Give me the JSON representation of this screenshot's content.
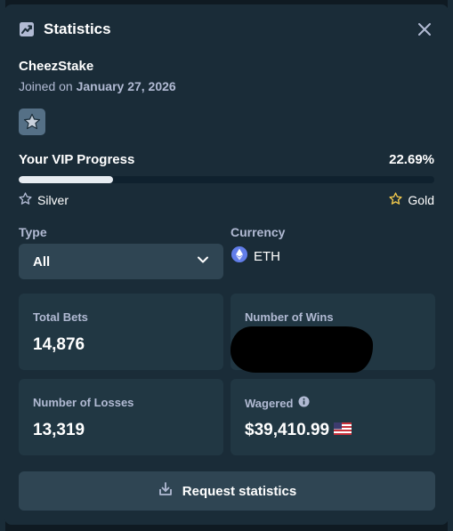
{
  "modal": {
    "title": "Statistics",
    "icon": "chart-icon",
    "close_icon": "close-icon"
  },
  "user": {
    "name": "CheezStake",
    "joined_prefix": "Joined on",
    "joined_date": "January 27, 2026",
    "badge_icon": "silver-star-badge-icon"
  },
  "vip": {
    "label": "Your VIP Progress",
    "percent_text": "22.69%",
    "progress": 0.2269,
    "current_tier": "Silver",
    "next_tier": "Gold",
    "gold_color": "#f2c94c"
  },
  "filters": {
    "type_label": "Type",
    "type_value": "All",
    "currency_label": "Currency",
    "currency_value": "ETH",
    "currency_icon": "eth-icon"
  },
  "stats": {
    "total_bets_label": "Total Bets",
    "total_bets_value": "14,876",
    "wins_label": "Number of Wins",
    "losses_label": "Number of Losses",
    "losses_value": "13,319",
    "wagered_label": "Wagered",
    "wagered_value": "$39,410.99",
    "wagered_info_icon": "info-icon",
    "wagered_flag_icon": "us-flag-icon"
  },
  "actions": {
    "request_label": "Request statistics",
    "request_icon": "download-icon"
  },
  "colors": {
    "panel": "#1a2c38",
    "card": "#213743",
    "button": "#2f4553",
    "muted_text": "#b1bad3"
  }
}
